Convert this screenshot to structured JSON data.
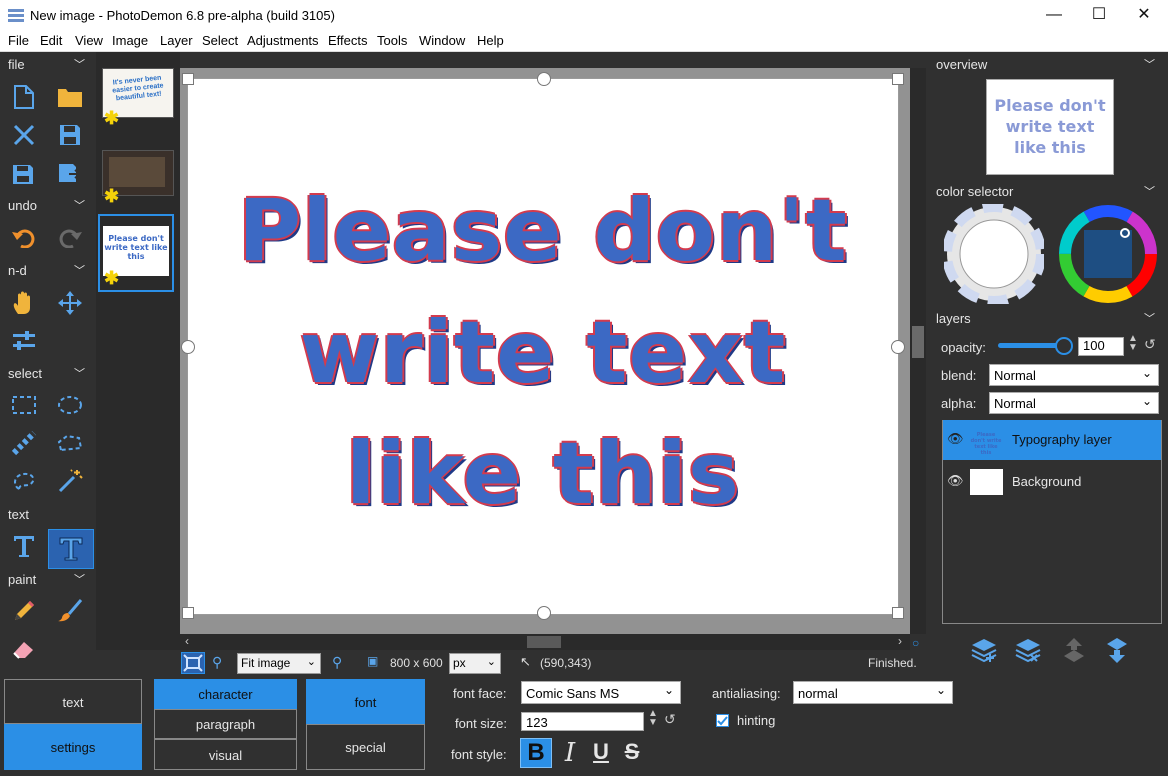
{
  "window": {
    "title": "New image  -  PhotoDemon 6.8 pre-alpha (build 3105)"
  },
  "menu": [
    "File",
    "Edit",
    "View",
    "Image",
    "Layer",
    "Select",
    "Adjustments",
    "Effects",
    "Tools",
    "Window",
    "Help"
  ],
  "toolbox": {
    "sections": {
      "file": "file",
      "undo": "undo",
      "nd": "n-d",
      "select": "select",
      "text": "text",
      "paint": "paint"
    }
  },
  "canvas": {
    "lines": [
      "Please don't",
      "write text",
      "like this"
    ]
  },
  "thumbnails": {
    "first_text": "It's never been easier to create beautiful text!",
    "third_text": "Please don't write text like this"
  },
  "statusbar": {
    "zoom": "Fit image",
    "size": "800 x 600",
    "unit": "px",
    "coords": "(590,343)",
    "status": "Finished."
  },
  "options": {
    "left_tabs": [
      "text",
      "settings"
    ],
    "mid_tabs": [
      "character",
      "paragraph",
      "visual"
    ],
    "font_tabs": [
      "font",
      "special"
    ],
    "font_face_label": "font face:",
    "font_face": "Comic Sans MS",
    "font_size_label": "font size:",
    "font_size": "123",
    "font_style_label": "font style:",
    "antialiasing_label": "antialiasing:",
    "antialiasing": "normal",
    "hinting_label": "hinting"
  },
  "panels": {
    "overview": "overview",
    "overview_text": "Please don't write text like this",
    "color_selector": "color selector",
    "layers": "layers",
    "opacity_label": "opacity:",
    "opacity": "100",
    "opacity_value": 100,
    "blend_label": "blend:",
    "blend": "Normal",
    "alpha_label": "alpha:",
    "alpha": "Normal",
    "layer_items": [
      "Typography layer",
      "Background"
    ]
  },
  "colors": {
    "accent": "#2b8fe6",
    "dark_bg": "#303030",
    "text_blue": "#3c69c4",
    "text_outline": "#d33b4e"
  }
}
